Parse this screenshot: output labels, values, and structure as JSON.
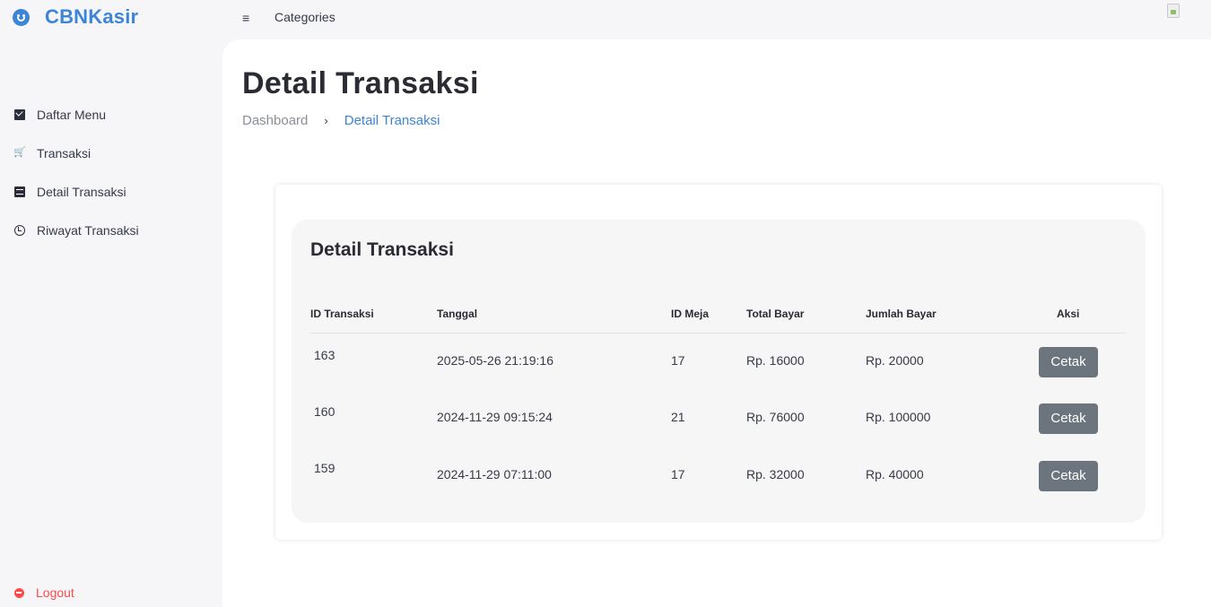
{
  "brand": {
    "title": "CBNKasir",
    "color": "#3c85d8"
  },
  "topbar": {
    "menu_glyph": "≡",
    "categories_label": "Categories"
  },
  "sidebar": {
    "items": [
      {
        "label": "Daftar Menu",
        "icon": "mail-icon"
      },
      {
        "label": "Transaksi",
        "icon": "cart-icon"
      },
      {
        "label": "Detail Transaksi",
        "icon": "receipt-icon"
      },
      {
        "label": "Riwayat Transaksi",
        "icon": "history-icon"
      }
    ],
    "logout": {
      "label": "Logout",
      "icon": "logout-icon",
      "color": "#ff4a4a"
    }
  },
  "page": {
    "title": "Detail Transaksi",
    "breadcrumb": {
      "home": "Dashboard",
      "separator": "›",
      "current": "Detail Transaksi"
    }
  },
  "card": {
    "title": "Detail Transaksi",
    "columns": [
      "ID Transaksi",
      "Tanggal",
      "ID Meja",
      "Total Bayar",
      "Jumlah Bayar",
      "Aksi"
    ],
    "rows": [
      {
        "id": "163",
        "tanggal": "2025-05-26 21:19:16",
        "meja": "17",
        "total": "Rp. 16000",
        "jumlah": "Rp. 20000",
        "action": "Cetak"
      },
      {
        "id": "160",
        "tanggal": "2024-11-29 09:15:24",
        "meja": "21",
        "total": "Rp. 76000",
        "jumlah": "Rp. 100000",
        "action": "Cetak"
      },
      {
        "id": "159",
        "tanggal": "2024-11-29 07:11:00",
        "meja": "17",
        "total": "Rp. 32000",
        "jumlah": "Rp. 40000",
        "action": "Cetak"
      }
    ]
  }
}
